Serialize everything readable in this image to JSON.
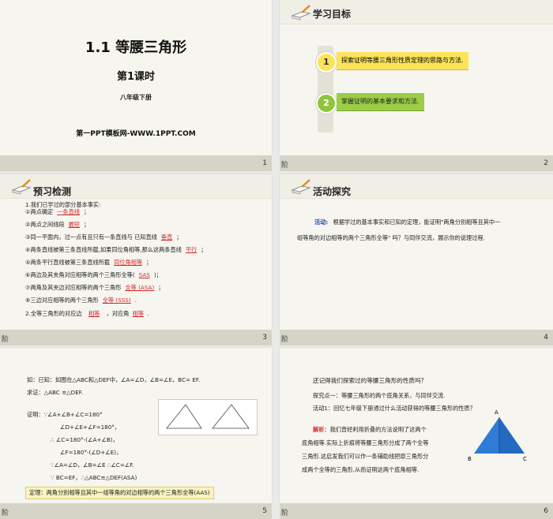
{
  "slide1": {
    "title": "1.1 等腰三角形",
    "subtitle": "第1课时",
    "grade": "八年级下册",
    "footer": "第一PPT模板网-WWW.1PPT.COM",
    "page": "1"
  },
  "slide2": {
    "header": "学习目标",
    "goals": [
      {
        "num": "1",
        "text": "探索证明等腰三角形性质定理的思路与方法."
      },
      {
        "num": "2",
        "text": "掌握证明的基本要求和方法."
      }
    ],
    "page": "2",
    "left_mark": "阶"
  },
  "slide3": {
    "header": "预习检测",
    "intro": "1.我们已学过的部分基本事实:",
    "items": [
      {
        "mark": "①",
        "pre": "两点确定",
        "fill": "一条直线",
        "post": "；"
      },
      {
        "mark": "②",
        "pre": "两点之间线段",
        "fill": "最短",
        "post": "；"
      },
      {
        "mark": "③",
        "pre": "同一平面内，过一点有且只有一条直线与  已知直线",
        "fill": "垂直",
        "post": "；"
      },
      {
        "mark": "④",
        "pre": "两条直线被第三条直线所截,如果同位角相等,那么这两条直线",
        "fill": "平行",
        "post": "；"
      },
      {
        "mark": "⑤",
        "pre": "两条平行直线被第三条直线所截",
        "fill": "同位角相等",
        "post": "；"
      },
      {
        "mark": "⑥",
        "pre": "两边及其夹角对应相等的两个三角形全等(",
        "fill": "SAS",
        "post": ")；"
      },
      {
        "mark": "⑦",
        "pre": "两角及其夹边对应相等的两个三角形",
        "fill": "全等 (ASA)",
        "post": "；"
      },
      {
        "mark": "⑧",
        "pre": "三边对应相等的两个三角形",
        "fill": "全等 (SSS)",
        "post": "."
      }
    ],
    "q2": {
      "pre": "2.全等三角形的对应边",
      "fill1": "相等",
      "mid": "，对应角",
      "fill2": "相等",
      "post": "."
    },
    "page": "3",
    "left_mark": "阶"
  },
  "slide4": {
    "header": "活动探究",
    "label": "活动:",
    "line1": "根据学过的基本事实和已知的定理，能证明\"两角分别相等且其中一",
    "line2": "组等角的对边相等的两个三角形全等\"  吗？与同伴交流，展示你的说理过程.",
    "page": "4",
    "left_mark": "阶"
  },
  "slide5": {
    "lines": [
      "如：已知：如图在△ABC和△DEF中，∠A=∠D，∠B=∠E，BC=  EF.",
      "求证：△ABC ≌△DEF.",
      "证明：∵∠A+∠B+∠C=180°",
      "∠D+∠E+∠F=180°，",
      "∴ ∠C=180°-(∠A+∠B)，",
      "∠F=180°-(∠D+∠E)，",
      "∵∠A=∠D，∠B=∠E  ∴∠C=∠F.",
      "∵ BC=EF，∴△ABC≌△DEF(ASA)"
    ],
    "theorem": "定理：两角分别相等且其中一组等角的对边相等的两个三角形全等(AAS)",
    "page": "5",
    "left_mark": "阶"
  },
  "slide6": {
    "q": "还记得我们探索过的等腰三角形的性质吗？",
    "point1": "探究点一：等腰三角形的两个底角关系，与同伴交流.",
    "act1": "活动1：回忆七年级下册通过什么活动获得的等腰三角形的性质？",
    "analysis_label": "解析",
    "analysis_lines": [
      "：我们曾经利用折叠的方法说明了这两个",
      "底角相等.实际上折痕将等腰三角形分成了两个全等",
      "三角形.这启发我们可以作一条辅助线把原三角形分",
      "成两个全等的三角形,从而证明这两个底角相等."
    ],
    "tri_labels": {
      "A": "A",
      "B": "B",
      "C": "C"
    },
    "page": "6",
    "left_mark": "阶"
  }
}
